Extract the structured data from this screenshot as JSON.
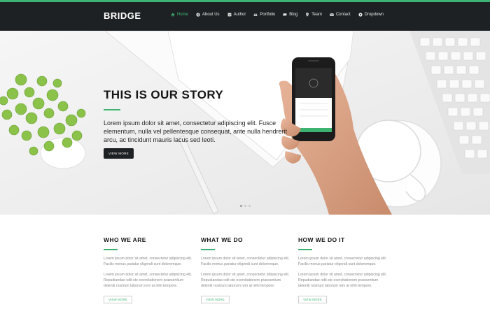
{
  "brand": "BRIDGE",
  "nav": [
    {
      "label": "Home",
      "icon": "home-icon",
      "active": true
    },
    {
      "label": "About Us",
      "icon": "globe-icon"
    },
    {
      "label": "Author",
      "icon": "checkbox-icon"
    },
    {
      "label": "Portfolio",
      "icon": "car-icon"
    },
    {
      "label": "Blog",
      "icon": "chat-icon"
    },
    {
      "label": "Team",
      "icon": "pin-icon"
    },
    {
      "label": "Contact",
      "icon": "mail-icon"
    },
    {
      "label": "Dropdown",
      "icon": "gear-icon"
    }
  ],
  "hero": {
    "title": "THIS IS OUR STORY",
    "text": "Lorem ipsum dolor sit amet, consectetur adipiscing elit. Fusce elementum, nulla vel pellentesque consequat, ante nulla hendrerit arcu, ac tincidunt mauris lacus sed leoti.",
    "button": "VIEW MORE",
    "slides": 3,
    "active_slide": 0
  },
  "columns": [
    {
      "title": "WHO WE ARE",
      "p1": "Lorem ipsum dolor sit amet, consectetur adipiscing elit. Facilis menus pariatur eligendi sunt doloremque.",
      "p2": "Lorem ipsum dolor sit amet, consectetur adipiscing elit. Repudiandae odit ste exercitationem praesentium deleniti nostrum laborum rem at nihil tempore.",
      "button": "VIEW MORE"
    },
    {
      "title": "WHAT WE DO",
      "p1": "Lorem ipsum dolor sit amet, consectetur adipiscing elit. Facilis menus pariatur eligendi sunt doloremque.",
      "p2": "Lorem ipsum dolor sit amet, consectetur adipiscing elit. Repudiandae odit ste exercitationem praesentium deleniti nostrum laborum rem at nihil tempore.",
      "button": "VIEW MORE"
    },
    {
      "title": "HOW WE DO IT",
      "p1": "Lorem ipsum dolor sit amet, consectetur adipiscing elit. Facilis menus pariatur eligendi sunt doloremque.",
      "p2": "Lorem ipsum dolor sit amet, consectetur adipiscing elit. Repudiandae odit ste exercitationem praesentium deleniti nostrum laborum rem at nihil tempore.",
      "button": "VIEW MORE"
    }
  ],
  "colors": {
    "accent": "#3cb371",
    "header_bg": "#1e2123",
    "button_dark": "#1e2123"
  }
}
